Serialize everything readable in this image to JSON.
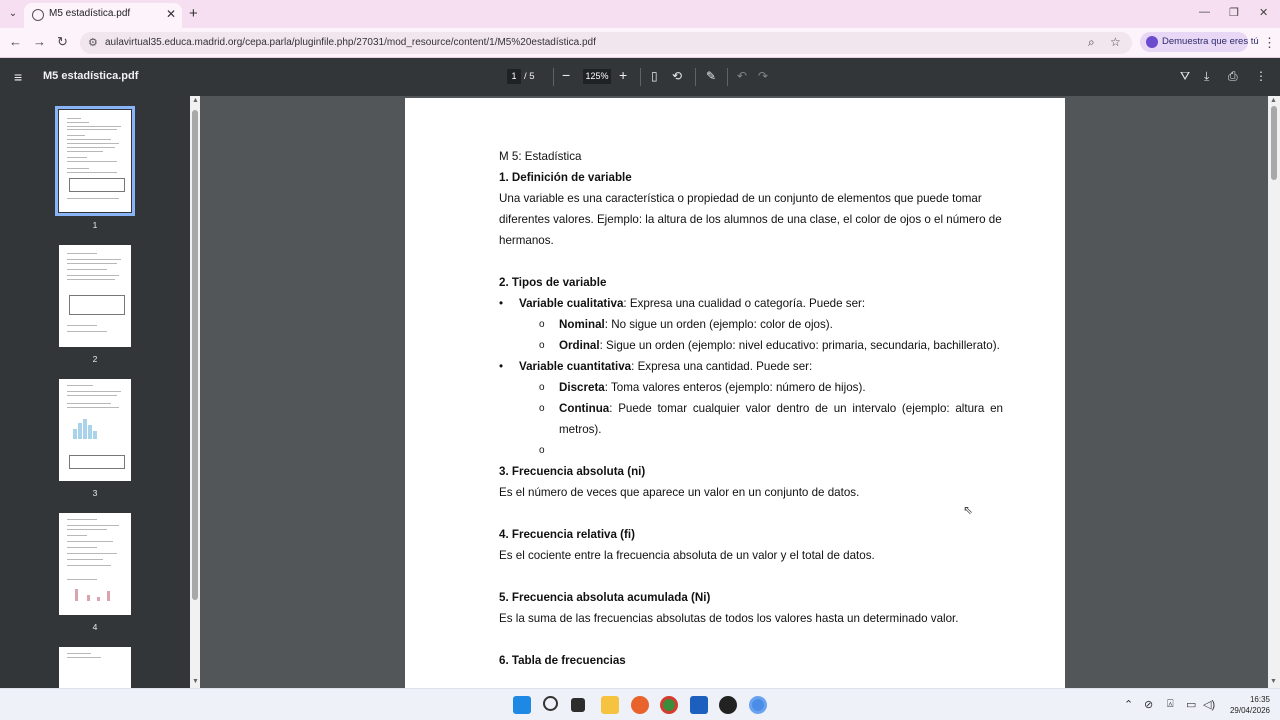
{
  "browser": {
    "tab_title": "M5 estadística.pdf",
    "url": "aulavirtual35.educa.madrid.org/cepa.parla/pluginfile.php/27031/mod_resource/content/1/M5%20estadística.pdf",
    "gemini_chip": "Demuestra que eres tú"
  },
  "viewer": {
    "title": "M5 estadística.pdf",
    "current_page": "1",
    "total_pages": "/ 5",
    "zoom": "125%"
  },
  "thumbnails": [
    {
      "label": "1"
    },
    {
      "label": "2"
    },
    {
      "label": "3"
    },
    {
      "label": "4"
    }
  ],
  "document": {
    "heading": "M 5: Estadística",
    "s1_title": "1. Definición de variable",
    "s1_text": "Una variable es una característica o propiedad de un conjunto de elementos que puede tomar diferentes valores. Ejemplo: la altura de los alumnos de una clase, el color de ojos o el número de hermanos.",
    "s2_title": "2. Tipos de variable",
    "cual_term": "Variable cualitativa",
    "cual_text": ": Expresa una cualidad o categoría. Puede ser:",
    "nominal_term": "Nominal",
    "nominal_text": ": No sigue un orden (ejemplo: color de ojos).",
    "ordinal_term": "Ordinal",
    "ordinal_text": ": Sigue un orden (ejemplo: nivel educativo: primaria, secundaria, bachillerato).",
    "cuant_term": "Variable cuantitativa",
    "cuant_text": ": Expresa una cantidad. Puede ser:",
    "discreta_term": "Discreta",
    "discreta_text": ": Toma valores enteros (ejemplo: número de hijos).",
    "continua_term": "Continua",
    "continua_text": ": Puede tomar cualquier valor dentro de un intervalo (ejemplo: altura en metros).",
    "s3_title": "3. Frecuencia absoluta (ni)",
    "s3_text": "Es el número de veces que aparece un valor en un conjunto de datos.",
    "s4_title": "4. Frecuencia relativa (fi)",
    "s4_text": "Es el cociente entre la frecuencia absoluta de un valor y el total de datos.",
    "s5_title": "5. Frecuencia absoluta acumulada (Ni)",
    "s5_text": "Es la suma de las frecuencias absolutas de todos los valores hasta un determinado valor.",
    "s6_title": "6. Tabla de frecuencias"
  },
  "taskbar": {
    "time": "16:35",
    "date": "29/04/2026"
  },
  "icons": {
    "tab_menu": "chevron-down-icon",
    "tab_close": "close-icon",
    "new_tab": "plus-icon",
    "back": "back-arrow-icon",
    "forward": "forward-arrow-icon",
    "reload": "reload-icon",
    "zoom_lens": "search-icon",
    "bookmark": "star-icon",
    "pdf_menu": "hamburger-menu-icon",
    "fit": "fit-page-icon",
    "rotate": "rotate-icon",
    "annotate": "pen-icon",
    "undo": "undo-icon",
    "redo": "redo-icon",
    "drive": "drive-icon",
    "download": "download-icon",
    "print": "print-icon",
    "more": "more-vert-icon"
  }
}
